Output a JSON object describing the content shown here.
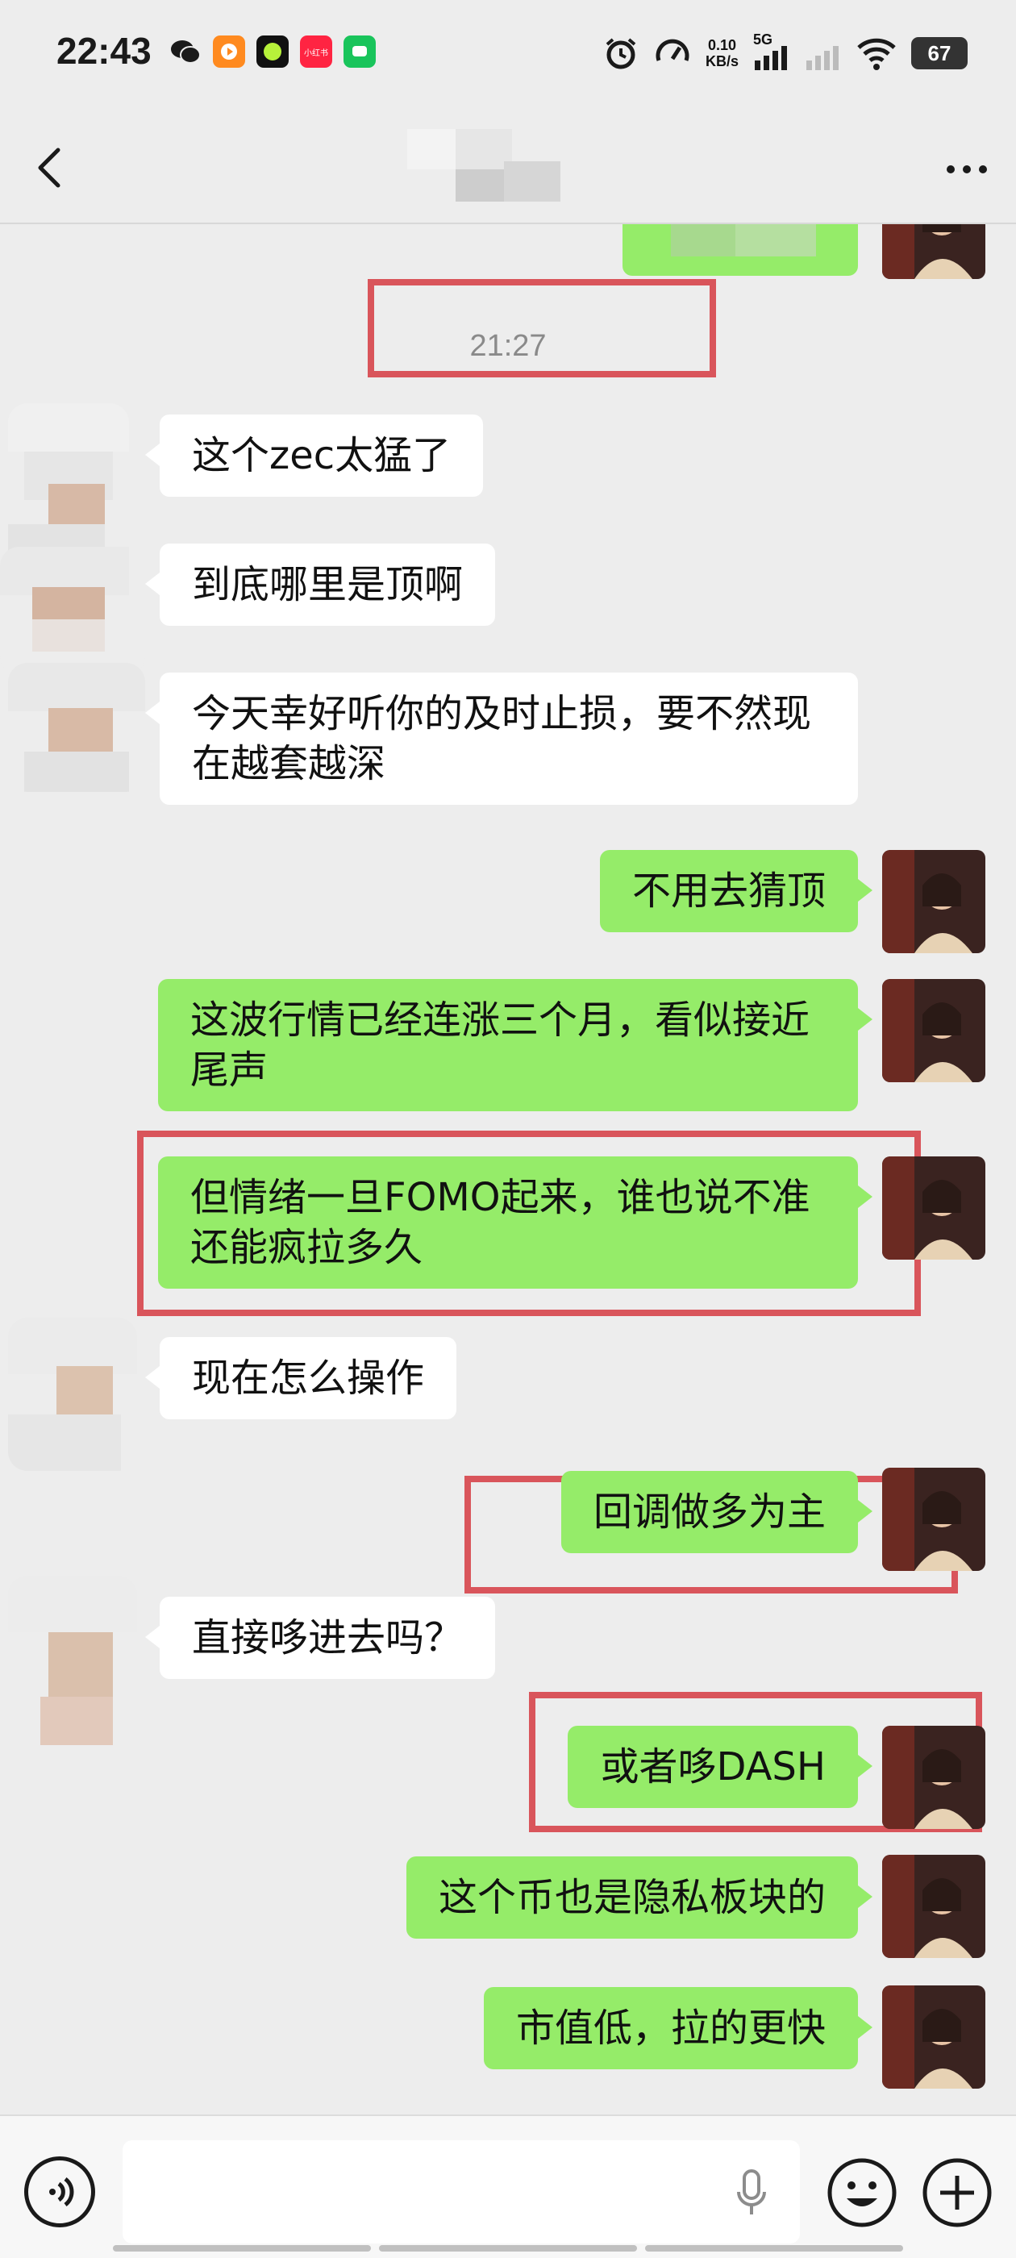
{
  "status_bar": {
    "time": "22:43",
    "network_speed_value": "0.10",
    "network_speed_unit": "KB/s",
    "signal_label": "5G",
    "battery_percent": "67",
    "app_icon_labels": [
      "小红书"
    ]
  },
  "header": {
    "back_icon": "chevron-left-icon",
    "more_icon": "more-dots-icon"
  },
  "chat": {
    "timestamp": "21:27",
    "messages": [
      {
        "side": "in",
        "text": "这个zec太猛了"
      },
      {
        "side": "in",
        "text": "到底哪里是顶啊"
      },
      {
        "side": "in",
        "text": "今天幸好听你的及时止损，要不然现在越套越深"
      },
      {
        "side": "out",
        "text": "不用去猜顶"
      },
      {
        "side": "out",
        "text": "这波行情已经连涨三个月，看似接近尾声"
      },
      {
        "side": "out",
        "text": "但情绪一旦FOMO起来，谁也说不准还能疯拉多久"
      },
      {
        "side": "in",
        "text": "现在怎么操作"
      },
      {
        "side": "out",
        "text": "回调做多为主"
      },
      {
        "side": "in",
        "text": "直接哆进去吗？"
      },
      {
        "side": "out",
        "text": "或者哆DASH"
      },
      {
        "side": "out",
        "text": "这个币也是隐私板块的"
      },
      {
        "side": "out",
        "text": "市值低，拉的更快"
      }
    ]
  },
  "input_bar": {
    "voice_icon": "voice-icon",
    "mic_icon": "mic-icon",
    "emoji_icon": "emoji-icon",
    "plus_icon": "plus-icon"
  },
  "colors": {
    "background": "#ededed",
    "outgoing_bubble": "#95ec69",
    "incoming_bubble": "#ffffff",
    "highlight_box": "#d9555b"
  }
}
